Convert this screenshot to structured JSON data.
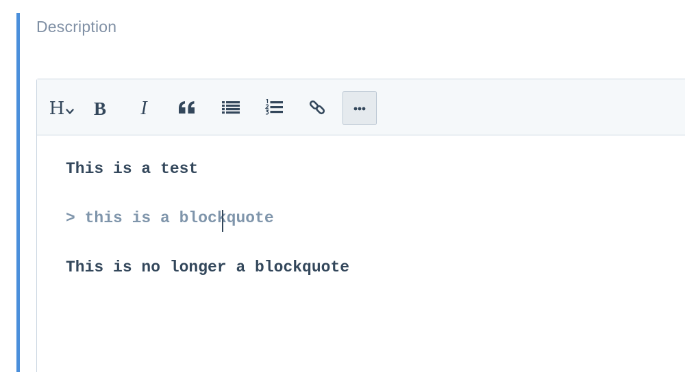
{
  "field": {
    "label": "Description"
  },
  "toolbar": {
    "heading_label": "H",
    "bold_label": "B",
    "italic_label": "I",
    "icons": [
      "chevron-down-icon",
      "blockquote-icon",
      "bulleted-list-icon",
      "numbered-list-icon",
      "link-icon",
      "more-options-icon"
    ]
  },
  "editor": {
    "lines": [
      "This is a test",
      "> this is a blockquote",
      "This is no longer a blockquote"
    ]
  },
  "colors": {
    "accent": "#4a8fdb",
    "text": "#33475b",
    "label": "#7f8fa4",
    "quote_text": "#7f95ab",
    "toolbar_bg": "#f5f8fa",
    "border": "#cbd6e2"
  }
}
